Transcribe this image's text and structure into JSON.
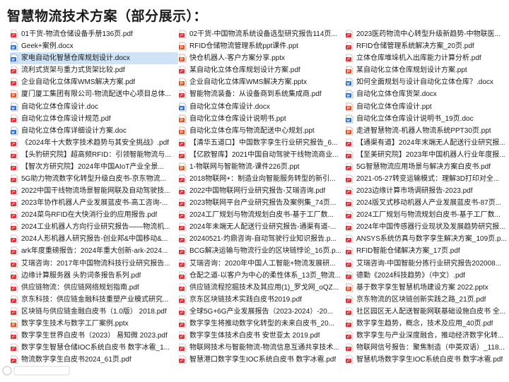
{
  "page": {
    "title": "智慧物流技术方案（部分展示）："
  },
  "icon_colors": {
    "pdf": "#d9343a",
    "doc": "#2b6cc4",
    "ppt": "#d9532a",
    "pptx": "#d9532a",
    "docx": "#2b6cc4"
  },
  "columns": [
    [
      {
        "name": "01干货-物流仓储设备手册136页.pdf",
        "type": "pdf"
      },
      {
        "name": "Geek+案例.docx",
        "type": "doc"
      },
      {
        "name": "家电自动化智慧仓库规划设计.docx",
        "type": "doc",
        "selected": true
      },
      {
        "name": "流利式货架与重力式货架比较.pdf",
        "type": "pdf"
      },
      {
        "name": "企业自动化立体库WMS解决方案.pdf",
        "type": "pdf"
      },
      {
        "name": "厦门厦工集团有限公司-物流配送中心项目总体...",
        "type": "ppt"
      },
      {
        "name": "自动化立体仓库设计.doc",
        "type": "doc"
      },
      {
        "name": "自动化立体仓库设计规范.pdf",
        "type": "pdf"
      },
      {
        "name": "自动化立体仓库详细设计方案.doc",
        "type": "doc"
      },
      {
        "name": "《2024年十大数字技术趋势与其安全挑战》.pdf",
        "type": "pdf"
      },
      {
        "name": "【头豹研究院】超高频RFID：引领智能物流与...",
        "type": "pdf"
      },
      {
        "name": "【智次方研究院】2024年中国AIoT产业全景...",
        "type": "pdf"
      },
      {
        "name": "5G助力物流数字化转型升级白皮书-京东物流...",
        "type": "pdf"
      },
      {
        "name": "2022中国干线物流场景智能网联及自动驾驶技...",
        "type": "pdf"
      },
      {
        "name": "2023年协作机器人产业发展蓝皮书-高工咨询-...",
        "type": "pdf"
      },
      {
        "name": "2024菜鸟RFID在大快消行业的应用报告.pdf",
        "type": "pdf"
      },
      {
        "name": "2024工业机器人方向行业研究报告——物流机...",
        "type": "pdf"
      },
      {
        "name": "2024人形机器人研究报告-创业邦&中国移动&...",
        "type": "pdf"
      },
      {
        "name": "ark年度重磅报告：2024年重大创新-ark-2024...",
        "type": "pdf"
      },
      {
        "name": "艾瑞咨询：2017年中国物流科技行业研究报告...",
        "type": "pdf"
      },
      {
        "name": "边缘计算服务器 头豹词条报告系列.pdf",
        "type": "pdf"
      },
      {
        "name": "供应链物流：供应链网络规划指南.pdf",
        "type": "pdf"
      },
      {
        "name": "京东科技：供应链金融科技重塑产业模式研究...",
        "type": "pdf"
      },
      {
        "name": "区块链与供应链金融白皮书（1.0版） 2018.pdf",
        "type": "pdf"
      },
      {
        "name": "数字孪生技术与数字工厂案例.pptx",
        "type": "ppt"
      },
      {
        "name": "数字孪生世界白皮书（2023） 易知微 2023.pdf",
        "type": "pdf"
      },
      {
        "name": "数字孪生智慧仓储IOC系统白皮书 数字冰雹_1...",
        "type": "pdf"
      },
      {
        "name": "物流数字孪生白皮书2024_61页.pdf",
        "type": "pdf"
      }
    ],
    [
      {
        "name": "02干货-中国物流系统设备选型研究报告114页...",
        "type": "pdf"
      },
      {
        "name": "RFID仓储物流管理系统ppt课件.ppt",
        "type": "ppt"
      },
      {
        "name": "快仓机器人-客户方案分享.pptx",
        "type": "ppt"
      },
      {
        "name": "某自动化立体仓库规划设计方案.pdf",
        "type": "pdf"
      },
      {
        "name": "企业自动化立体库WMS解决方案.pptx",
        "type": "ppt"
      },
      {
        "name": "智能物流装备：从设备商到系统集成商.pdf",
        "type": "pdf"
      },
      {
        "name": "自动化立体仓库设计.docx",
        "type": "doc"
      },
      {
        "name": "自动化立体仓库设计说明书.ppt",
        "type": "ppt"
      },
      {
        "name": "自动化立体仓库与物流配送中心规划.ppt",
        "type": "ppt"
      },
      {
        "name": "【清华五道口】中国数字孪生行业研究报告_6...",
        "type": "pdf"
      },
      {
        "name": "【亿欧智库】2021中国自动驾驶干线物流商业...",
        "type": "pdf"
      },
      {
        "name": "1-物联网与智能物流-课件226页.ppt",
        "type": "ppt"
      },
      {
        "name": "2018物联网+：制造业向智能服务转型的新引...",
        "type": "pdf"
      },
      {
        "name": "2022中国物联网行业研究报告-艾瑞咨询.pdf",
        "type": "pdf"
      },
      {
        "name": "2023物联网平台产业研究报告及案例集_74页...",
        "type": "pdf"
      },
      {
        "name": "2024工厂规划与物流规划白皮书-基于工厂数...",
        "type": "pdf"
      },
      {
        "name": "2024年未端无人配送行业研究报告-通渠有道-...",
        "type": "pdf"
      },
      {
        "name": "20240521-灼鼎咨询-自动驾驶行业知识报告.p...",
        "type": "pdf"
      },
      {
        "name": "BCG解决运输与物流行业的区块链悖论_16页.p...",
        "type": "pdf"
      },
      {
        "name": "艾瑞咨询：2020年中国人工智能+物流发展研...",
        "type": "pdf"
      },
      {
        "name": "仓配之道-以客户为中心的柔性体系_13页_物流...",
        "type": "pdf"
      },
      {
        "name": "供应链流程挖掘技术及其应用(1)_罗戈网_oQZ...",
        "type": "pdf"
      },
      {
        "name": "京东区块链技术实践白皮书2019.pdf",
        "type": "pdf"
      },
      {
        "name": "全球5G+6G产业发展报告（2023-2024）-20...",
        "type": "pdf"
      },
      {
        "name": "数字孪生将推动数字化转型的未来白皮书_20...",
        "type": "pdf"
      },
      {
        "name": "数字孪生体技术白皮书 安世亚太 2019.pdf",
        "type": "pdf"
      },
      {
        "name": "物联网技术与智能物流-物流信息互通共享技术...",
        "type": "pdf"
      },
      {
        "name": "智慧港口数字孪生IOC系统白皮书 数字冰雹.pdf",
        "type": "pdf"
      }
    ],
    [
      {
        "name": "2023医药物流中心转型升级新趋势-中物联医...",
        "type": "pdf"
      },
      {
        "name": "RFID仓储管理系统解决方案_20页.pdf",
        "type": "pdf"
      },
      {
        "name": "立体仓库堆垛机入出库能力计算分析.pdf",
        "type": "pdf"
      },
      {
        "name": "某自动化立体仓库规划设计方案.ppt",
        "type": "ppt"
      },
      {
        "name": "如何全面规划与设计自动化立体仓库？.docx",
        "type": "doc"
      },
      {
        "name": "自动化立体仓库货架.docx",
        "type": "doc"
      },
      {
        "name": "自动化立体仓库设计.ppt",
        "type": "ppt"
      },
      {
        "name": "自动化立体仓库设计说明书_19页.doc",
        "type": "doc"
      },
      {
        "name": "走进智慧物流-机器人物流系统PPT30页.ppt",
        "type": "ppt"
      },
      {
        "name": "【通渠有道】2024年末端无人配送行业研究报...",
        "type": "pdf"
      },
      {
        "name": "【至美研究院】2023年中国机器人行业年度报...",
        "type": "pdf"
      },
      {
        "name": "5G智慧物流应用场景与解决方案白皮书.pdf",
        "type": "pdf"
      },
      {
        "name": "2021-05-27转变运输模式：理解3D打印对全...",
        "type": "pdf"
      },
      {
        "name": "2023边缘计算市场调研报告-2023.pdf",
        "type": "pdf"
      },
      {
        "name": "2024版叉式移动机器人产业发展蓝皮书-87页...",
        "type": "pdf"
      },
      {
        "name": "2024工厂规划与物流规划白皮书-基于工厂数...",
        "type": "pdf"
      },
      {
        "name": "2024年中国传感器行业现状及发展趋势研究报...",
        "type": "pdf"
      },
      {
        "name": "ANSYS系统仿真与数字孪生解决方案_109页.p...",
        "type": "pdf"
      },
      {
        "name": "RFID智能仓储解决方案_17页.pdf",
        "type": "pdf"
      },
      {
        "name": "艾瑞咨询-中国智能分拣行业研究报告202008...",
        "type": "pdf"
      },
      {
        "name": "德勤《2024科技趋势》（中文）.pdf",
        "type": "pdf"
      },
      {
        "name": "基于数字孪生智慧机场建设方案 2022.pptx",
        "type": "ppt"
      },
      {
        "name": "京东物流的区块链创新实践之路_21页.pdf",
        "type": "pdf"
      },
      {
        "name": "社区园区无人配送智能网联基础设施白皮书 全...",
        "type": "pdf"
      },
      {
        "name": "数字孪生趋势，概念，技术及应用_40页.pdf",
        "type": "pdf"
      },
      {
        "name": "数字孪生与产业深度融合，推动经济数字化转...",
        "type": "pdf"
      },
      {
        "name": "物联网信号报告：聚焦制造（中英双语）_118...",
        "type": "pdf"
      },
      {
        "name": "智慧机场数字孪生IOC系统白皮书 数字冰雹.pdf",
        "type": "pdf"
      }
    ]
  ]
}
